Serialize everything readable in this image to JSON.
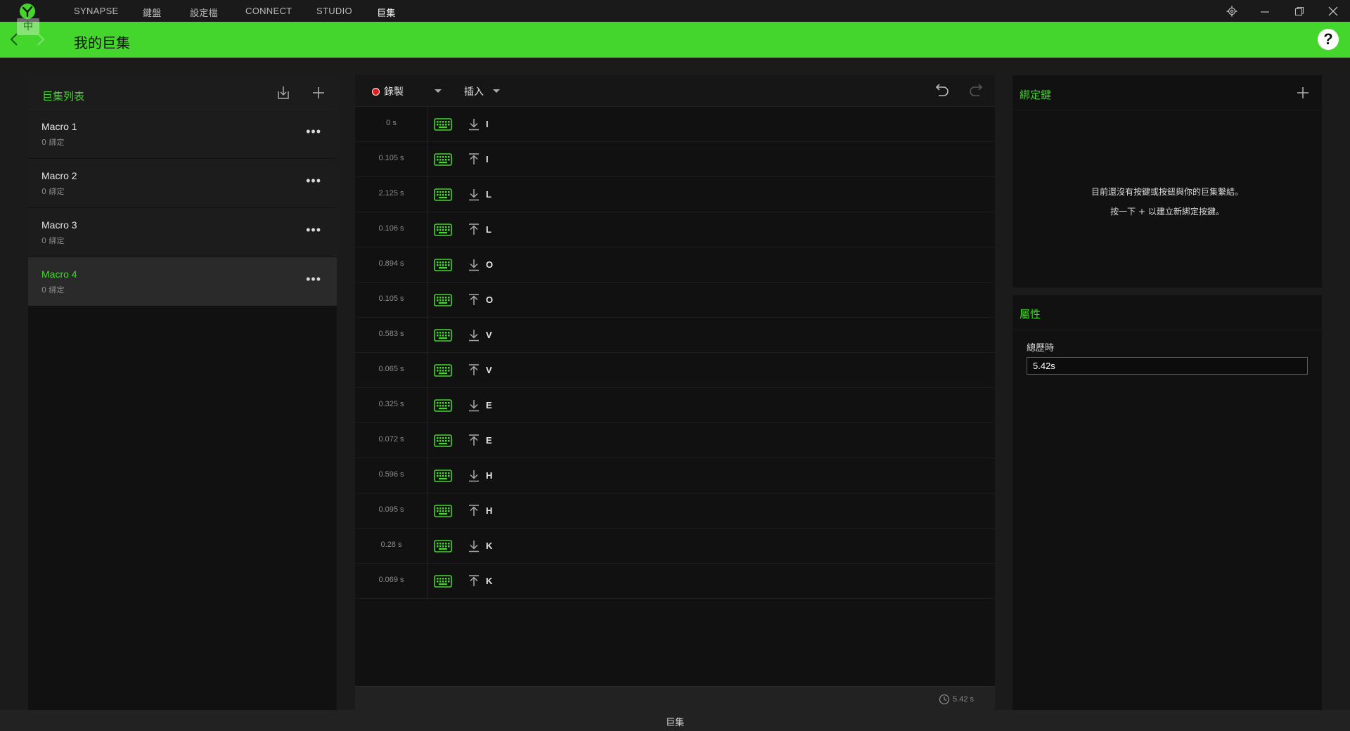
{
  "nav": {
    "tabs": [
      "SYNAPSE",
      "鍵盤",
      "設定檔",
      "CONNECT",
      "STUDIO",
      "巨集"
    ],
    "active_tab": "巨集"
  },
  "header": {
    "ime_indicator": "中",
    "title": "我的巨集",
    "help": "?"
  },
  "colors": {
    "accent": "#44d62c",
    "record": "#e21b1b",
    "panel": "#111111"
  },
  "macro_list": {
    "title": "巨集列表",
    "items": [
      {
        "name": "Macro 1",
        "sub": "0 綁定"
      },
      {
        "name": "Macro 2",
        "sub": "0 綁定"
      },
      {
        "name": "Macro 3",
        "sub": "0 綁定"
      },
      {
        "name": "Macro 4",
        "sub": "0 綁定"
      }
    ],
    "selected_index": 3
  },
  "editor": {
    "record_label": "錄製",
    "insert_label": "插入",
    "events": [
      {
        "time": "0 s",
        "dir": "down",
        "key": "I"
      },
      {
        "time": "0.105 s",
        "dir": "up",
        "key": "I"
      },
      {
        "time": "2.125 s",
        "dir": "down",
        "key": "L"
      },
      {
        "time": "0.106 s",
        "dir": "up",
        "key": "L"
      },
      {
        "time": "0.894 s",
        "dir": "down",
        "key": "O"
      },
      {
        "time": "0.105 s",
        "dir": "up",
        "key": "O"
      },
      {
        "time": "0.583 s",
        "dir": "down",
        "key": "V"
      },
      {
        "time": "0.065 s",
        "dir": "up",
        "key": "V"
      },
      {
        "time": "0.325 s",
        "dir": "down",
        "key": "E"
      },
      {
        "time": "0.072 s",
        "dir": "up",
        "key": "E"
      },
      {
        "time": "0.596 s",
        "dir": "down",
        "key": "H"
      },
      {
        "time": "0.095 s",
        "dir": "up",
        "key": "H"
      },
      {
        "time": "0.28 s",
        "dir": "down",
        "key": "K"
      },
      {
        "time": "0.069 s",
        "dir": "up",
        "key": "K"
      }
    ],
    "total_time": "5.42 s"
  },
  "bindings": {
    "title": "綁定鍵",
    "empty_line1": "目前還沒有按鍵或按鈕與你的巨集繫結。",
    "empty_line2": "按一下 + 以建立新綁定按鍵。"
  },
  "properties": {
    "title": "屬性",
    "duration_label": "總歷時",
    "duration_value": "5.42s"
  },
  "statusbar": {
    "text": "巨集"
  }
}
